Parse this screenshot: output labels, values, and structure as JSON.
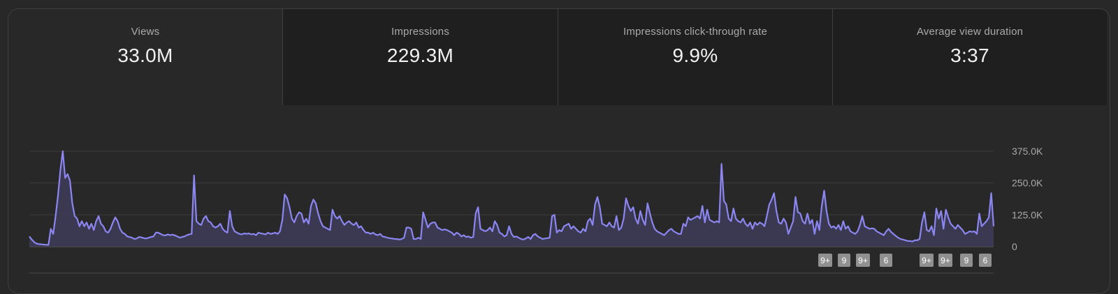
{
  "metrics": [
    {
      "label": "Views",
      "value": "33.0M"
    },
    {
      "label": "Impressions",
      "value": "229.3M"
    },
    {
      "label": "Impressions click-through rate",
      "value": "9.9%"
    },
    {
      "label": "Average view duration",
      "value": "3:37"
    }
  ],
  "colors": {
    "line": "#8b86f0",
    "fill": "#3d3b57",
    "grid": "#3d3d3d",
    "badge": "#909090"
  },
  "badges": [
    "9+",
    "9",
    "9+",
    "6",
    "9+",
    "9+",
    "9",
    "6"
  ],
  "chart_data": {
    "type": "area",
    "title": "",
    "xlabel": "",
    "ylabel": "",
    "ylim": [
      0,
      375000
    ],
    "y_ticks": [
      "375.0K",
      "250.0K",
      "125.0K",
      "0"
    ],
    "grid": true,
    "series": [
      {
        "values": [
          40000,
          28000,
          18000,
          12000,
          10000,
          9000,
          8000,
          7000,
          7000,
          70000,
          50000,
          120000,
          200000,
          300000,
          375000,
          270000,
          285000,
          260000,
          170000,
          120000,
          110000,
          80000,
          100000,
          80000,
          95000,
          70000,
          90000,
          65000,
          100000,
          120000,
          90000,
          80000,
          60000,
          55000,
          70000,
          95000,
          115000,
          100000,
          70000,
          55000,
          50000,
          40000,
          38000,
          35000,
          30000,
          32000,
          38000,
          36000,
          33000,
          32000,
          35000,
          38000,
          40000,
          55000,
          55000,
          50000,
          45000,
          44000,
          48000,
          45000,
          47000,
          44000,
          40000,
          35000,
          38000,
          40000,
          45000,
          48000,
          50000,
          280000,
          100000,
          90000,
          85000,
          110000,
          120000,
          100000,
          95000,
          80000,
          75000,
          80000,
          90000,
          70000,
          60000,
          55000,
          140000,
          80000,
          60000,
          55000,
          50000,
          48000,
          52000,
          50000,
          52000,
          48000,
          50000,
          45000,
          55000,
          52000,
          50000,
          48000,
          55000,
          50000,
          52000,
          55000,
          50000,
          60000,
          105000,
          205000,
          190000,
          155000,
          110000,
          95000,
          120000,
          135000,
          130000,
          95000,
          110000,
          90000,
          160000,
          185000,
          170000,
          130000,
          100000,
          80000,
          75000,
          70000,
          65000,
          145000,
          120000,
          110000,
          120000,
          100000,
          85000,
          95000,
          100000,
          90000,
          85000,
          95000,
          75000,
          80000,
          65000,
          55000,
          55000,
          50000,
          55000,
          48000,
          45000,
          50000,
          40000,
          38000,
          35000,
          33000,
          32000,
          30000,
          30000,
          28000,
          30000,
          35000,
          75000,
          75000,
          70000,
          30000,
          30000,
          35000,
          30000,
          135000,
          105000,
          75000,
          90000,
          95000,
          95000,
          75000,
          70000,
          65000,
          68000,
          65000,
          60000,
          55000,
          45000,
          55000,
          50000,
          40000,
          45000,
          38000,
          40000,
          35000,
          38000,
          130000,
          155000,
          70000,
          65000,
          60000,
          65000,
          75000,
          60000,
          100000,
          85000,
          55000,
          50000,
          40000,
          45000,
          80000,
          50000,
          38000,
          40000,
          35000,
          30000,
          28000,
          32000,
          38000,
          30000,
          45000,
          50000,
          40000,
          35000,
          30000,
          32000,
          33000,
          35000,
          120000,
          125000,
          55000,
          65000,
          60000,
          80000,
          85000,
          90000,
          70000,
          80000,
          70000,
          60000,
          55000,
          70000,
          60000,
          100000,
          110000,
          85000,
          165000,
          195000,
          155000,
          90000,
          85000,
          80000,
          95000,
          80000,
          75000,
          120000,
          65000,
          75000,
          110000,
          190000,
          160000,
          140000,
          155000,
          110000,
          90000,
          140000,
          105000,
          85000,
          170000,
          130000,
          95000,
          70000,
          60000,
          55000,
          50000,
          45000,
          55000,
          65000,
          70000,
          60000,
          55000,
          50000,
          50000,
          90000,
          80000,
          115000,
          105000,
          110000,
          115000,
          120000,
          110000,
          160000,
          95000,
          145000,
          105000,
          100000,
          95000,
          100000,
          95000,
          325000,
          180000,
          165000,
          110000,
          100000,
          150000,
          110000,
          100000,
          95000,
          110000,
          90000,
          80000,
          95000,
          70000,
          95000,
          85000,
          95000,
          90000,
          80000,
          120000,
          165000,
          185000,
          210000,
          140000,
          95000,
          90000,
          110000,
          95000,
          50000,
          75000,
          100000,
          195000,
          135000,
          130000,
          100000,
          90000,
          130000,
          90000,
          105000,
          50000,
          100000,
          65000,
          160000,
          220000,
          140000,
          90000,
          75000,
          80000,
          70000,
          85000,
          65000,
          100000,
          70000,
          80000,
          60000,
          55000,
          50000,
          60000,
          85000,
          120000,
          80000,
          75000,
          70000,
          72000,
          70000,
          60000,
          55000,
          50000,
          45000,
          60000,
          70000,
          58000,
          50000,
          42000,
          35000,
          30000,
          28000,
          25000,
          22000,
          22000,
          20000,
          25000,
          25000,
          30000,
          95000,
          135000,
          65000,
          60000,
          80000,
          45000,
          150000,
          110000,
          140000,
          70000,
          145000,
          115000,
          90000,
          80000,
          70000,
          85000,
          75000,
          65000,
          50000,
          55000,
          60000,
          58000,
          60000,
          50000,
          130000,
          80000,
          90000,
          100000,
          115000,
          210000,
          80000
        ]
      }
    ]
  }
}
